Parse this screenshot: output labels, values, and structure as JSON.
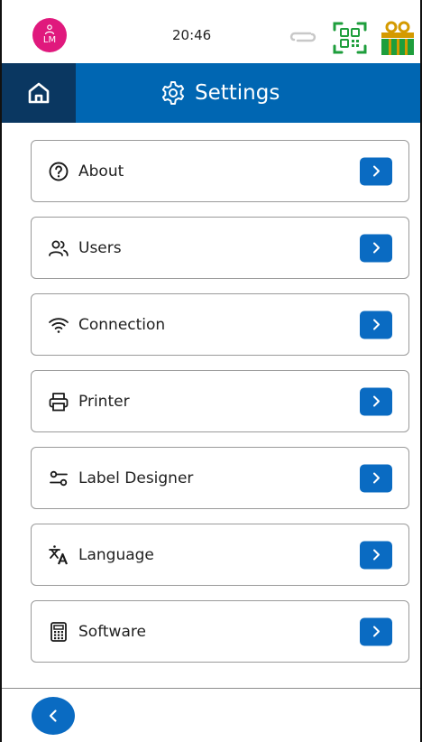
{
  "status_bar": {
    "user_initials": "LM",
    "time": "20:46"
  },
  "header": {
    "title": "Settings"
  },
  "menu": {
    "items": [
      {
        "label": "About",
        "icon": "question-circle-icon"
      },
      {
        "label": "Users",
        "icon": "users-icon"
      },
      {
        "label": "Connection",
        "icon": "wifi-icon"
      },
      {
        "label": "Printer",
        "icon": "printer-icon"
      },
      {
        "label": "Label Designer",
        "icon": "sliders-icon"
      },
      {
        "label": "Language",
        "icon": "translate-icon"
      },
      {
        "label": "Software",
        "icon": "calculator-icon"
      }
    ]
  },
  "colors": {
    "header_blue": "#0066b2",
    "home_dark_blue": "#0a3761",
    "button_blue": "#0a6bc2",
    "avatar_pink": "#e0197d",
    "status_green": "#1e9e3c",
    "cart_gold": "#d49a00"
  }
}
